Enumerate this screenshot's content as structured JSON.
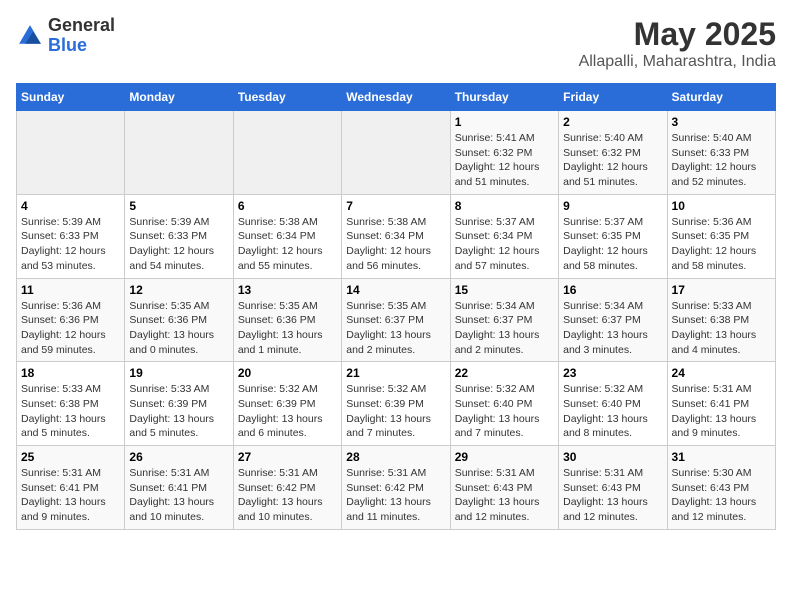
{
  "header": {
    "logo_general": "General",
    "logo_blue": "Blue",
    "title": "May 2025",
    "subtitle": "Allapalli, Maharashtra, India"
  },
  "weekdays": [
    "Sunday",
    "Monday",
    "Tuesday",
    "Wednesday",
    "Thursday",
    "Friday",
    "Saturday"
  ],
  "weeks": [
    [
      {
        "day": "",
        "empty": true
      },
      {
        "day": "",
        "empty": true
      },
      {
        "day": "",
        "empty": true
      },
      {
        "day": "",
        "empty": true
      },
      {
        "day": "1",
        "sunrise": "5:41 AM",
        "sunset": "6:32 PM",
        "daylight": "12 hours and 51 minutes."
      },
      {
        "day": "2",
        "sunrise": "5:40 AM",
        "sunset": "6:32 PM",
        "daylight": "12 hours and 51 minutes."
      },
      {
        "day": "3",
        "sunrise": "5:40 AM",
        "sunset": "6:33 PM",
        "daylight": "12 hours and 52 minutes."
      }
    ],
    [
      {
        "day": "4",
        "sunrise": "5:39 AM",
        "sunset": "6:33 PM",
        "daylight": "12 hours and 53 minutes."
      },
      {
        "day": "5",
        "sunrise": "5:39 AM",
        "sunset": "6:33 PM",
        "daylight": "12 hours and 54 minutes."
      },
      {
        "day": "6",
        "sunrise": "5:38 AM",
        "sunset": "6:34 PM",
        "daylight": "12 hours and 55 minutes."
      },
      {
        "day": "7",
        "sunrise": "5:38 AM",
        "sunset": "6:34 PM",
        "daylight": "12 hours and 56 minutes."
      },
      {
        "day": "8",
        "sunrise": "5:37 AM",
        "sunset": "6:34 PM",
        "daylight": "12 hours and 57 minutes."
      },
      {
        "day": "9",
        "sunrise": "5:37 AM",
        "sunset": "6:35 PM",
        "daylight": "12 hours and 58 minutes."
      },
      {
        "day": "10",
        "sunrise": "5:36 AM",
        "sunset": "6:35 PM",
        "daylight": "12 hours and 58 minutes."
      }
    ],
    [
      {
        "day": "11",
        "sunrise": "5:36 AM",
        "sunset": "6:36 PM",
        "daylight": "12 hours and 59 minutes."
      },
      {
        "day": "12",
        "sunrise": "5:35 AM",
        "sunset": "6:36 PM",
        "daylight": "13 hours and 0 minutes."
      },
      {
        "day": "13",
        "sunrise": "5:35 AM",
        "sunset": "6:36 PM",
        "daylight": "13 hours and 1 minute."
      },
      {
        "day": "14",
        "sunrise": "5:35 AM",
        "sunset": "6:37 PM",
        "daylight": "13 hours and 2 minutes."
      },
      {
        "day": "15",
        "sunrise": "5:34 AM",
        "sunset": "6:37 PM",
        "daylight": "13 hours and 2 minutes."
      },
      {
        "day": "16",
        "sunrise": "5:34 AM",
        "sunset": "6:37 PM",
        "daylight": "13 hours and 3 minutes."
      },
      {
        "day": "17",
        "sunrise": "5:33 AM",
        "sunset": "6:38 PM",
        "daylight": "13 hours and 4 minutes."
      }
    ],
    [
      {
        "day": "18",
        "sunrise": "5:33 AM",
        "sunset": "6:38 PM",
        "daylight": "13 hours and 5 minutes."
      },
      {
        "day": "19",
        "sunrise": "5:33 AM",
        "sunset": "6:39 PM",
        "daylight": "13 hours and 5 minutes."
      },
      {
        "day": "20",
        "sunrise": "5:32 AM",
        "sunset": "6:39 PM",
        "daylight": "13 hours and 6 minutes."
      },
      {
        "day": "21",
        "sunrise": "5:32 AM",
        "sunset": "6:39 PM",
        "daylight": "13 hours and 7 minutes."
      },
      {
        "day": "22",
        "sunrise": "5:32 AM",
        "sunset": "6:40 PM",
        "daylight": "13 hours and 7 minutes."
      },
      {
        "day": "23",
        "sunrise": "5:32 AM",
        "sunset": "6:40 PM",
        "daylight": "13 hours and 8 minutes."
      },
      {
        "day": "24",
        "sunrise": "5:31 AM",
        "sunset": "6:41 PM",
        "daylight": "13 hours and 9 minutes."
      }
    ],
    [
      {
        "day": "25",
        "sunrise": "5:31 AM",
        "sunset": "6:41 PM",
        "daylight": "13 hours and 9 minutes."
      },
      {
        "day": "26",
        "sunrise": "5:31 AM",
        "sunset": "6:41 PM",
        "daylight": "13 hours and 10 minutes."
      },
      {
        "day": "27",
        "sunrise": "5:31 AM",
        "sunset": "6:42 PM",
        "daylight": "13 hours and 10 minutes."
      },
      {
        "day": "28",
        "sunrise": "5:31 AM",
        "sunset": "6:42 PM",
        "daylight": "13 hours and 11 minutes."
      },
      {
        "day": "29",
        "sunrise": "5:31 AM",
        "sunset": "6:43 PM",
        "daylight": "13 hours and 12 minutes."
      },
      {
        "day": "30",
        "sunrise": "5:31 AM",
        "sunset": "6:43 PM",
        "daylight": "13 hours and 12 minutes."
      },
      {
        "day": "31",
        "sunrise": "5:30 AM",
        "sunset": "6:43 PM",
        "daylight": "13 hours and 12 minutes."
      }
    ]
  ],
  "labels": {
    "sunrise": "Sunrise:",
    "sunset": "Sunset:",
    "daylight": "Daylight hours"
  }
}
